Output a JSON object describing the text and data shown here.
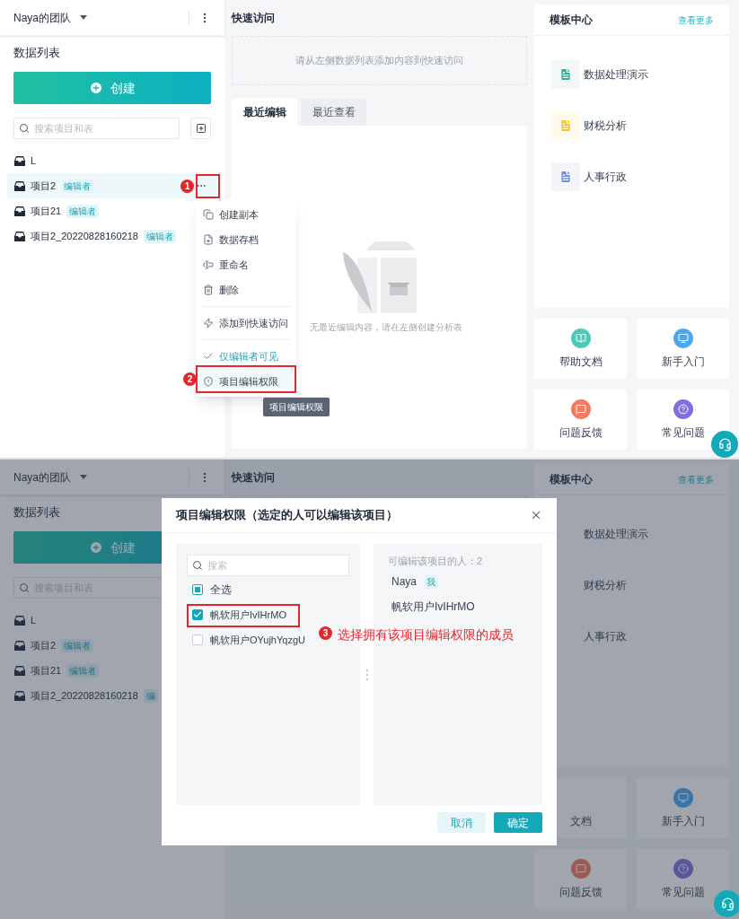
{
  "screens": [
    {
      "team": "Naya的团队",
      "sidebar_title": "数据列表",
      "create_button": "创建",
      "search_placeholder": "搜索项目和表",
      "add_button": true,
      "items": [
        {
          "name": "L",
          "selected": false
        },
        {
          "name": "项目2",
          "tag": "编辑者",
          "selected": true
        },
        {
          "name": "项目21",
          "tag": "编辑者",
          "selected": false
        },
        {
          "name": "项目2_20220828160218",
          "tag": "编辑者",
          "selected": false
        }
      ],
      "quick_access": {
        "title": "快速访问",
        "hint": "请从左侧数据列表添加内容到快速访问"
      },
      "tabs": [
        {
          "label": "最近编辑",
          "selected": true
        },
        {
          "label": "最近查看",
          "selected": false
        }
      ],
      "empty_text": "无最近编辑内容，请在左侧创建分析表",
      "templates": {
        "title": "模板中心",
        "more": "查看更多",
        "items": [
          {
            "name": "数据处理演示",
            "icon": true
          },
          {
            "name": "财税分析",
            "icon": true
          },
          {
            "name": "人事行政",
            "icon": true
          }
        ]
      },
      "tiles": [
        {
          "label": "帮助文档",
          "icon": true
        },
        {
          "label": "新手入门",
          "icon": true
        },
        {
          "label": "问题反馈",
          "icon": true
        },
        {
          "label": "常见问题",
          "icon": true
        }
      ]
    },
    {
      "team": "Naya的团队",
      "sidebar_title": "数据列表",
      "create_button": "创建",
      "search_placeholder": "搜索项目和表",
      "add_button": false,
      "items": [
        {
          "name": "L"
        },
        {
          "name": "项目2",
          "tag": "编辑者"
        },
        {
          "name": "项目21",
          "tag": "编辑者"
        },
        {
          "name": "项目2_20220828160218",
          "tag": "编"
        }
      ],
      "quick_access": {
        "title": "快速访问"
      },
      "templates": {
        "title": "模板中心",
        "more": "查看更多",
        "items": [
          {
            "name": "数据处理演示",
            "icon": false
          },
          {
            "name": "财税分析",
            "icon": false
          },
          {
            "name": "人事行政",
            "icon": false
          }
        ]
      },
      "tiles": [
        {
          "label": "文档",
          "icon": false
        },
        {
          "label": "新手入门",
          "icon": true
        },
        {
          "label": "问题反馈",
          "icon": true
        },
        {
          "label": "常见问题",
          "icon": true
        }
      ]
    }
  ],
  "menu": {
    "groups": [
      [
        {
          "label": "创建副本"
        },
        {
          "label": "数据存档"
        },
        {
          "label": "重命名"
        },
        {
          "label": "删除"
        }
      ],
      [
        {
          "label": "添加到快速访问"
        }
      ],
      [
        {
          "label": "仅编辑者可见",
          "checked": true
        },
        {
          "label": "项目编辑权限",
          "highlighted": true
        }
      ]
    ]
  },
  "tooltip": "项目编辑权限",
  "dialog": {
    "title": "项目编辑权限（选定的人可以编辑该项目）",
    "search_placeholder": "搜索",
    "select_all": {
      "label": "全选",
      "checked": false,
      "indeterminate": true
    },
    "members": [
      {
        "label": "帆软用户IvIHrMO",
        "checked": true
      },
      {
        "label": "帆软用户OYujhYqzgU",
        "checked": false
      }
    ],
    "selected_title": "可编辑该项目的人：2",
    "selected_members": [
      {
        "name": "Naya",
        "tag": "我"
      },
      {
        "name": "帆软用户IvIHrMO"
      }
    ],
    "buttons": [
      {
        "label": "取消",
        "kind": "secondary"
      },
      {
        "label": "确定",
        "kind": "primary"
      }
    ]
  },
  "annotations": [
    {
      "number": "1"
    },
    {
      "number": "2"
    },
    {
      "number": "3",
      "note": "选择拥有该项目编辑权限的成员"
    }
  ]
}
